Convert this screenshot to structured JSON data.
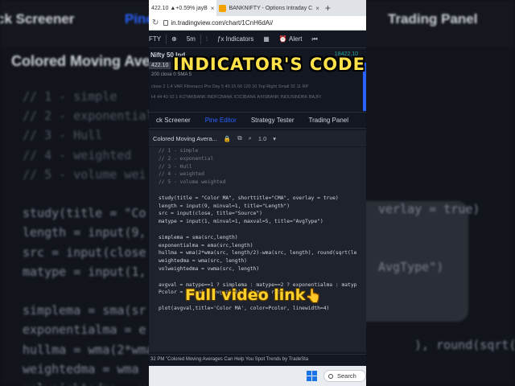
{
  "background": {
    "tabs": [
      "ck Screener",
      "Pine",
      "Trading Panel"
    ],
    "title": "Colored Moving Avera",
    "code_lines": [
      {
        "t": "// 1 - simple",
        "c": true
      },
      {
        "t": "// 2 - exponential",
        "c": true
      },
      {
        "t": "// 3 - Hull",
        "c": true
      },
      {
        "t": "// 4 - weighted",
        "c": true
      },
      {
        "t": "// 5 - volume wei",
        "c": true
      },
      {
        "t": "",
        "c": false
      },
      {
        "t": "study(title = \"Co",
        "c": false
      },
      {
        "t": "length = input(9,",
        "c": false
      },
      {
        "t": "src = input(close",
        "c": false
      },
      {
        "t": "matype = input(1,",
        "c": false
      },
      {
        "t": "",
        "c": false
      },
      {
        "t": "simplema = sma(sr",
        "c": false
      },
      {
        "t": "exponentialma = e",
        "c": false
      },
      {
        "t": "hullma = wma(2*wma",
        "c": false
      },
      {
        "t": "weightedma = wma",
        "c": false
      },
      {
        "t": "volweightedma = v",
        "c": false
      }
    ],
    "right_fragments": [
      "verlay = true)",
      "AvgType\")",
      "), round(sqrt(le"
    ]
  },
  "browser": {
    "tabs": [
      {
        "label": "422.10 ▲+0.59% jayB",
        "active": true
      },
      {
        "label": "BANKNIFTY - Options Intraday C",
        "active": false
      }
    ],
    "new_tab": "+",
    "url": "in.tradingview.com/chart/1CnH6dAi/"
  },
  "toolbar": {
    "symbol": "FTY",
    "interval": "5m",
    "indicators": "Indicators",
    "alert": "Alert"
  },
  "chart": {
    "legend_title": "Nifty 50 Ind",
    "price": "18422.10",
    "price_tag": "422.10",
    "sma_line": "200 close 0 SMA 5",
    "fib_line": "close 2 1.4 VAR Fibonacci Pro Day 5 40 15 60 120 10 Top Right Small 32 11 RP",
    "stocks_line": "HI 44 40 10 1 KOTAKBANK INDFCBANK ICICIBANK AXISBANK INDUSINDBK BAJFI"
  },
  "overlay": {
    "title": "INDICATOR'S  CODE",
    "video_link": "Full video link",
    "hand_emoji": "👆"
  },
  "pane_tabs": [
    {
      "label": "ck Screener",
      "active": false
    },
    {
      "label": "Pine Editor",
      "active": true
    },
    {
      "label": "Strategy Tester",
      "active": false
    },
    {
      "label": "Trading Panel",
      "active": false
    }
  ],
  "pine": {
    "script_name": "Colored Moving Avera...",
    "version": "1.0",
    "code": [
      "// 1 - simple",
      "// 2 - exponential",
      "// 3 - Hull",
      "// 4 - weighted",
      "// 5 - volume weighted",
      "",
      "study(title = \"Color MA\", shorttitle=\"CMA\", overlay = true)",
      "length = input(9, minval=1, title=\"Length\")",
      "src = input(close, title=\"Source\")",
      "matype = input(1, minval=1, maxval=5, title=\"AvgType\")",
      "",
      "simplema = sma(src,length)",
      "exponentialma = ema(src,length)",
      "hullma = wma(2*wma(src, length/2)-wma(src, length), round(sqrt(le",
      "weightedma = wma(src, length)",
      "volweightedma = vwma(src, length)",
      "",
      "avgval = matype==1 ? simplema : matype==2 ? exponentialma : matyp",
      "Pcolor = avgval > avgval[1] ? lime : red",
      "",
      "plot(avgval,title='Color MA', color=Pcolor, linewidth=4)"
    ]
  },
  "status": "32 PM \"Colored Moving Averages Can Help You Spot Trends by TradeSta",
  "taskbar": {
    "search": "Search"
  }
}
